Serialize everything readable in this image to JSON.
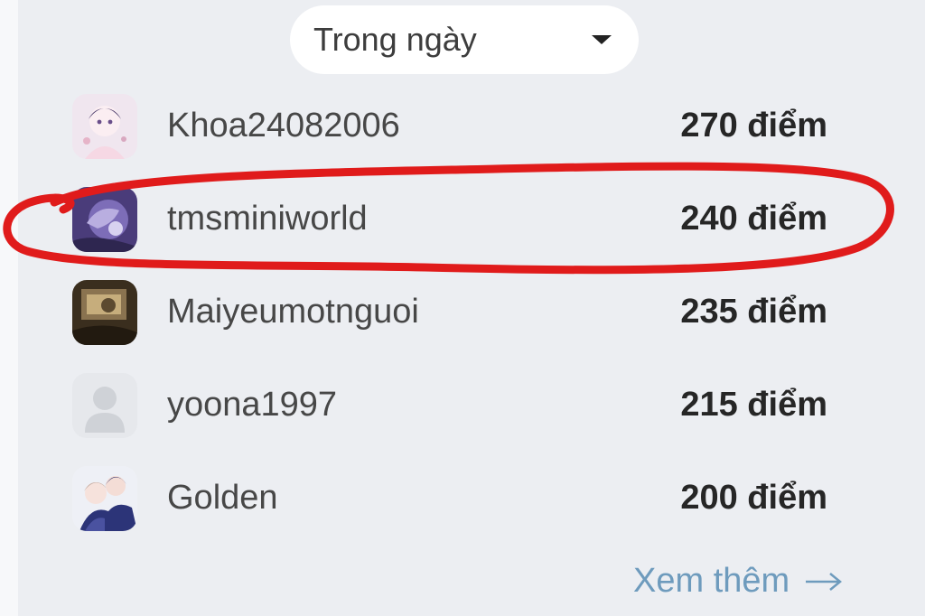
{
  "filter": {
    "selected": "Trong ngày"
  },
  "leaderboard": [
    {
      "username": "Khoa24082006",
      "points": "270 điểm",
      "avatar": "anime-avatar-icon"
    },
    {
      "username": "tmsminiworld",
      "points": "240 điểm",
      "avatar": "purple-art-avatar-icon"
    },
    {
      "username": "Maiyeumotnguoi",
      "points": "235 điểm",
      "avatar": "photo-avatar-icon"
    },
    {
      "username": "yoona1997",
      "points": "215 điểm",
      "avatar": "default-user-icon"
    },
    {
      "username": "Golden",
      "points": "200 điểm",
      "avatar": "couple-anime-avatar-icon"
    }
  ],
  "see_more": {
    "label": "Xem thêm"
  },
  "colors": {
    "panel_bg": "#eceef2",
    "highlight": "#e01b1b",
    "link": "#6e9bbd"
  }
}
